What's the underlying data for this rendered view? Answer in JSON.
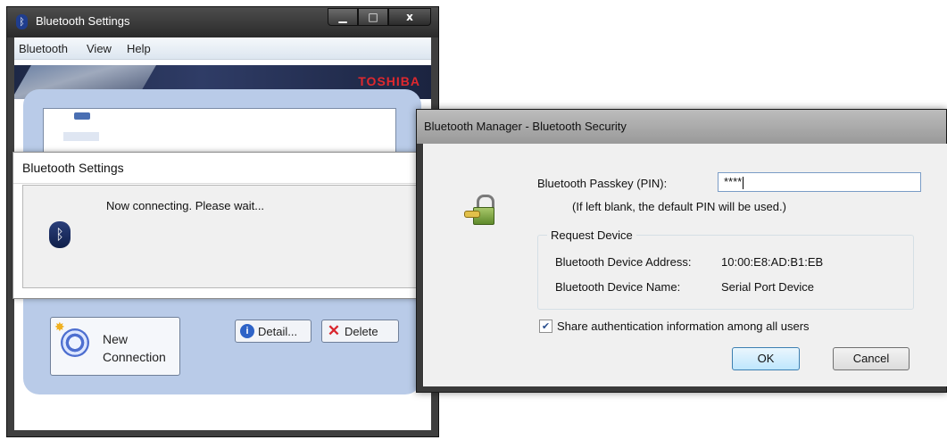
{
  "main_window": {
    "title": "Bluetooth Settings",
    "caption_buttons": {
      "minimize": "▁",
      "maximize": "□",
      "close": "x"
    },
    "menu": [
      "Bluetooth",
      "View",
      "Help"
    ],
    "brand": "TOSHIBA",
    "buttons": {
      "new_connection": "New\nConnection",
      "detail": "Detail...",
      "delete": "Delete"
    }
  },
  "connect_dialog": {
    "title": "Bluetooth Settings",
    "message": "Now connecting. Please wait..."
  },
  "security_dialog": {
    "title": "Bluetooth Manager - Bluetooth Security",
    "passkey_label": "Bluetooth Passkey (PIN):",
    "passkey_value": "****",
    "passkey_hint": "(If left blank, the default PIN will be used.)",
    "group_title": "Request Device",
    "address_label": "Bluetooth Device Address:",
    "address_value": "10:00:E8:AD:B1:EB",
    "name_label": "Bluetooth Device Name:",
    "name_value": "Serial Port Device",
    "share_checkbox_label": "Share authentication information among all users",
    "share_checked": true,
    "ok_label": "OK",
    "cancel_label": "Cancel"
  },
  "colors": {
    "accent_red": "#e0282e",
    "panel_blue": "#b9cbe8"
  }
}
